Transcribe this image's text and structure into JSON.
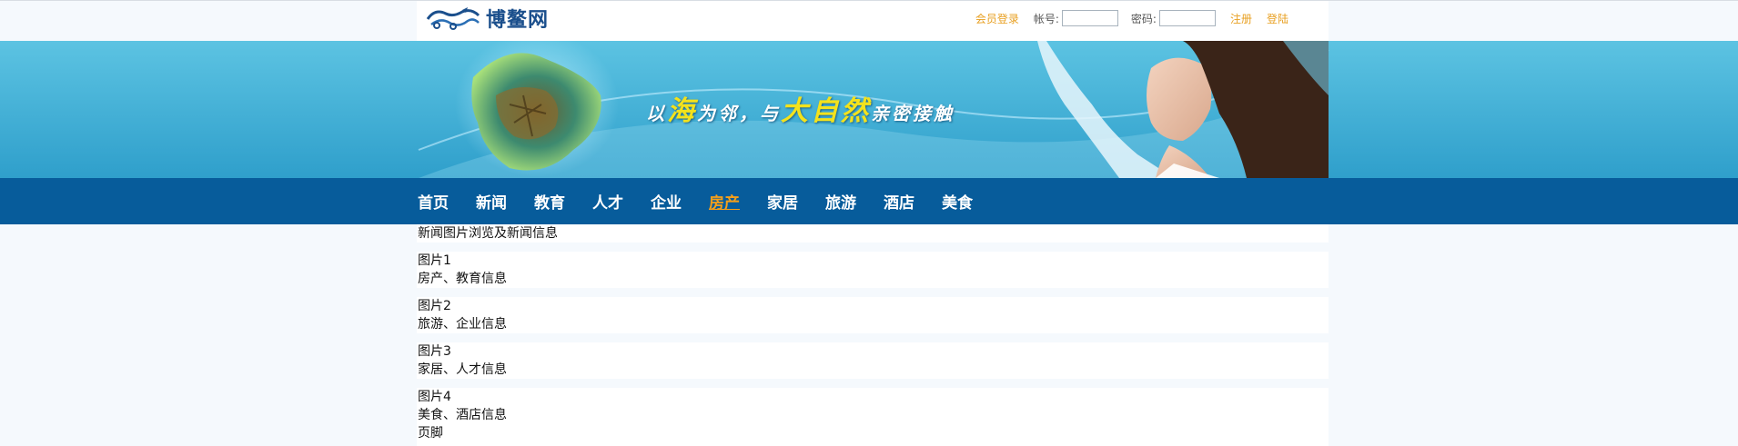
{
  "header": {
    "logo_text": "博鳌网",
    "member_login": "会员登录",
    "account_label": "帐号:",
    "password_label": "密码:",
    "account_value": "",
    "password_value": "",
    "register": "注册",
    "login": "登陆"
  },
  "banner": {
    "slogan_1": "以",
    "slogan_2": "海",
    "slogan_3": "为邻，与",
    "slogan_4": "大自然",
    "slogan_5": "亲密接触"
  },
  "nav": {
    "items": [
      "首页",
      "新闻",
      "教育",
      "人才",
      "企业",
      "房产",
      "家居",
      "旅游",
      "酒店",
      "美食"
    ],
    "active_index": 5
  },
  "content": {
    "heading": "新闻图片浏览及新闻信息",
    "blocks": [
      {
        "title": "图片1",
        "desc": "房产、教育信息"
      },
      {
        "title": "图片2",
        "desc": "旅游、企业信息"
      },
      {
        "title": "图片3",
        "desc": "家居、人才信息"
      },
      {
        "title": "图片4",
        "desc": "美食、酒店信息"
      }
    ],
    "footer": "页脚"
  },
  "colors": {
    "nav_bg": "#075c9b",
    "accent_orange": "#f6a019",
    "banner_bg": "#47b3d6",
    "page_bg": "#f5f9fd"
  }
}
